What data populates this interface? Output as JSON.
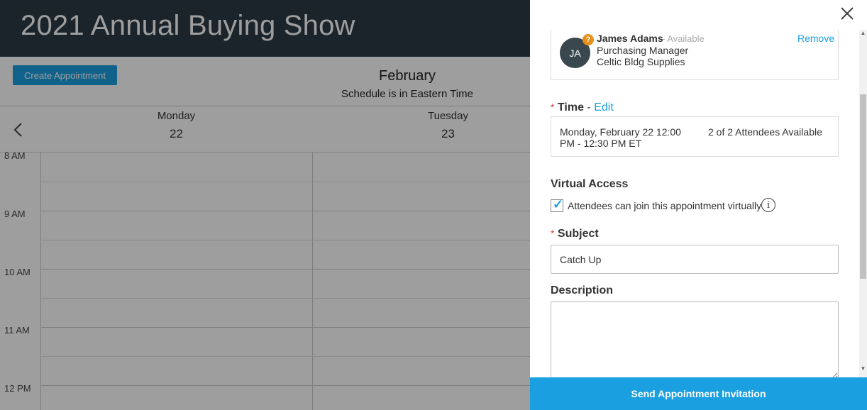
{
  "app": {
    "title": "2021 Annual Buying Show"
  },
  "toolbar": {
    "create_label": "Create Appointment",
    "month": "February",
    "timezone_note": "Schedule is in Eastern Time",
    "prev_icon": "chevron-left-icon"
  },
  "days": [
    {
      "name": "Monday",
      "date": "22"
    },
    {
      "name": "Tuesday",
      "date": "23"
    }
  ],
  "time_slots": [
    "8 AM",
    "9 AM",
    "10 AM",
    "11 AM",
    "12 PM"
  ],
  "panel": {
    "close_icon": "close-icon",
    "attendee": {
      "initials": "JA",
      "badge": "?",
      "name": "James Adams",
      "status": "- Available",
      "role": "Purchasing Manager",
      "company": "Celtic Bldg Supplies",
      "remove_label": "Remove"
    },
    "time": {
      "required_mark": "*",
      "label": "Time",
      "separator": "-",
      "edit_label": "Edit",
      "value": "Monday, February 22 12:00 PM - 12:30 PM ET",
      "availability": "2 of 2 Attendees Available"
    },
    "virtual": {
      "label": "Virtual Access",
      "checkbox_label": "Attendees can join this appointment virtually",
      "checked": true,
      "info_icon": "info-icon"
    },
    "subject": {
      "required_mark": "*",
      "label": "Subject",
      "value": "Catch Up"
    },
    "description": {
      "label": "Description",
      "value": ""
    },
    "send_label": "Send Appointment Invitation"
  },
  "colors": {
    "header_bg": "#2d3b45",
    "accent": "#1a9fe0",
    "required": "#e03c31",
    "badge": "#e8901a"
  }
}
